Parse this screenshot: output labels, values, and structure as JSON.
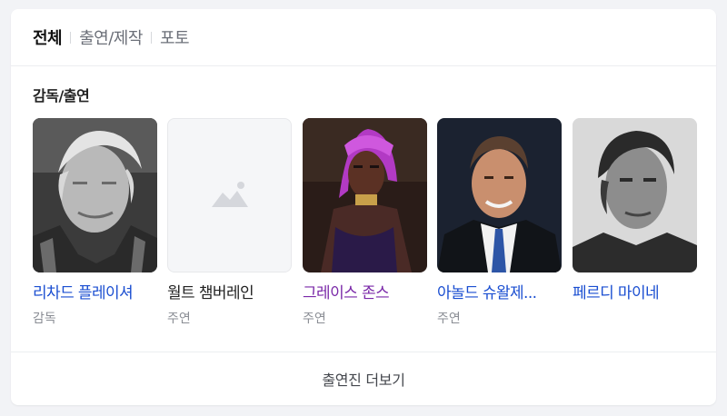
{
  "tabs": [
    {
      "label": "전체",
      "active": true
    },
    {
      "label": "출연/제작",
      "active": false
    },
    {
      "label": "포토",
      "active": false
    }
  ],
  "section_title": "감독/출연",
  "people": [
    {
      "name": "리차드 플레이셔",
      "role": "감독",
      "photo": "portrait-elderly-man"
    },
    {
      "name": "월트 챔버레인",
      "role": "주연",
      "photo": "image-placeholder-icon"
    },
    {
      "name": "그레이스 존스",
      "role": "주연",
      "photo": "portrait-woman-purple-headdress"
    },
    {
      "name": "아놀드 슈왈제...",
      "role": "주연",
      "photo": "portrait-man-suit"
    },
    {
      "name": "페르디 마이네",
      "role": "",
      "photo": "portrait-man-bw"
    }
  ],
  "more_label": "출연진 더보기",
  "colors": {
    "link": "#1a4ed1",
    "visited": "#7a28a8",
    "muted": "#8a8d94"
  }
}
